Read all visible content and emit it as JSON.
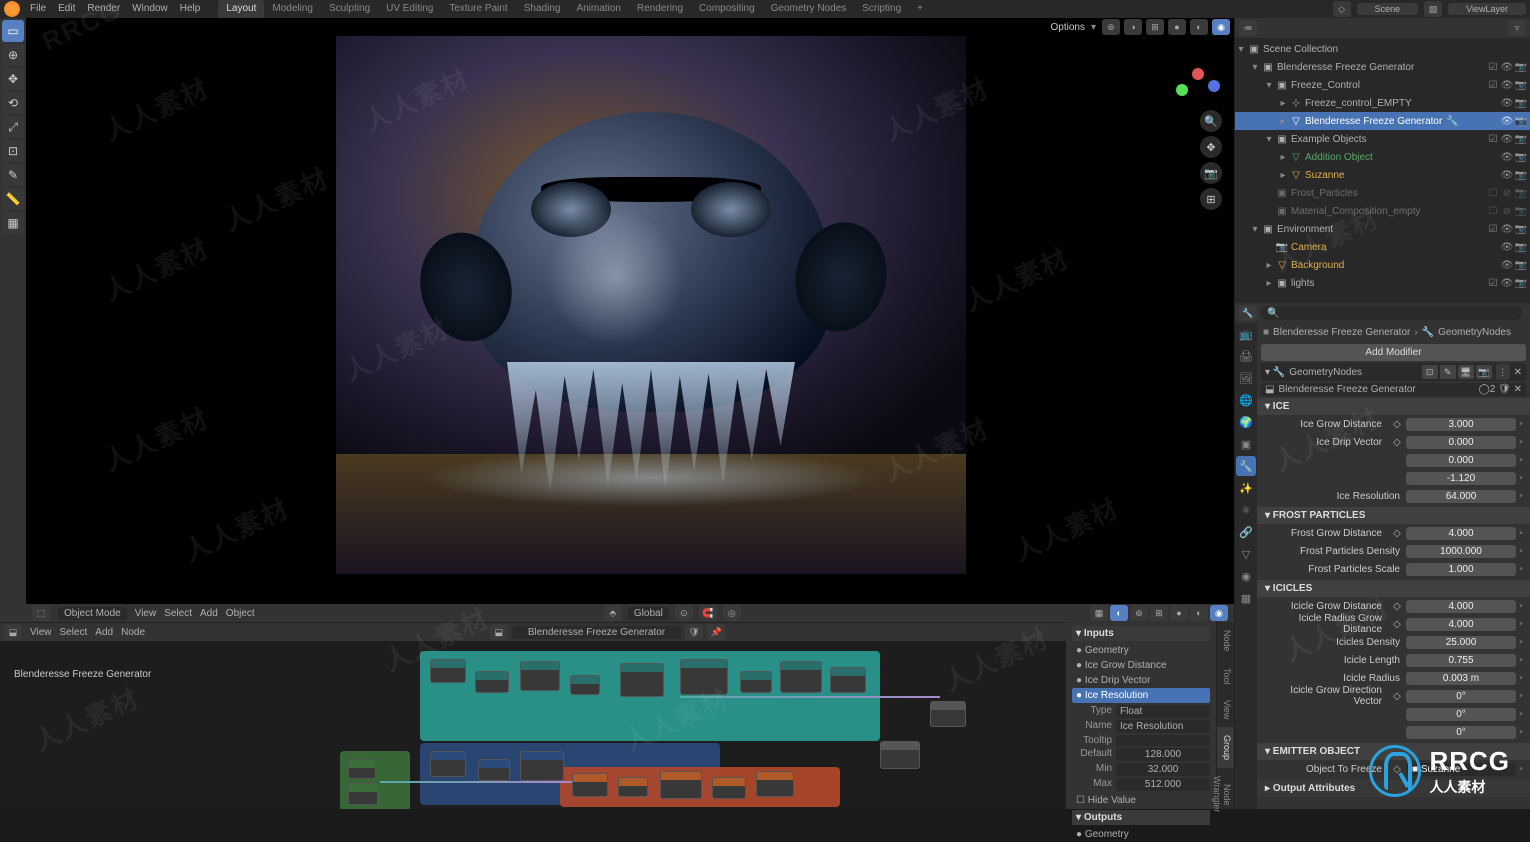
{
  "menu": [
    "File",
    "Edit",
    "Render",
    "Window",
    "Help"
  ],
  "workspaces": [
    "Layout",
    "Modeling",
    "Sculpting",
    "UV Editing",
    "Texture Paint",
    "Shading",
    "Animation",
    "Rendering",
    "Compositing",
    "Geometry Nodes",
    "Scripting"
  ],
  "workspace_active": "Layout",
  "scene": "Scene",
  "viewlayer": "ViewLayer",
  "viewport_header": {
    "mode": "Object Mode",
    "menus": [
      "View",
      "Select",
      "Add",
      "Object"
    ],
    "orientation": "Global",
    "options": "Options"
  },
  "node_editor_header": {
    "menus": [
      "View",
      "Select",
      "Add",
      "Node"
    ],
    "group": "Blenderesse Freeze Generator",
    "object": "Blenderesse Freeze Generator"
  },
  "outliner": [
    {
      "depth": 0,
      "twist": "▾",
      "icon": "▣",
      "name": "Scene Collection",
      "toggles": []
    },
    {
      "depth": 1,
      "twist": "▾",
      "icon": "▣",
      "name": "Blenderesse Freeze Generator",
      "toggles": [
        "☑",
        "👁",
        "📷"
      ]
    },
    {
      "depth": 2,
      "twist": "▾",
      "icon": "▣",
      "name": "Freeze_Control",
      "toggles": [
        "☑",
        "👁",
        "📷"
      ]
    },
    {
      "depth": 3,
      "twist": "▸",
      "icon": "⊹",
      "name": "Freeze_control_EMPTY",
      "toggles": [
        "",
        "👁",
        "📷"
      ]
    },
    {
      "depth": 3,
      "twist": "▸",
      "icon": "▽",
      "name": "Blenderesse Freeze Generator",
      "sel": true,
      "toggles": [
        "",
        "👁",
        "📷"
      ],
      "mod": "🔧"
    },
    {
      "depth": 2,
      "twist": "▾",
      "icon": "▣",
      "name": "Example Objects",
      "toggles": [
        "☑",
        "👁",
        "📷"
      ]
    },
    {
      "depth": 3,
      "twist": "▸",
      "icon": "▽",
      "name": "Addition Object",
      "toggles": [
        "",
        "👁",
        "📷"
      ],
      "color": "#5aa86a"
    },
    {
      "depth": 3,
      "twist": "▸",
      "icon": "▽",
      "name": "Suzanne",
      "toggles": [
        "",
        "👁",
        "📷"
      ],
      "color": "#e0b050"
    },
    {
      "depth": 2,
      "twist": "",
      "icon": "▣",
      "name": "Frost_Particles",
      "toggles": [
        "☐",
        "⊘",
        "📷"
      ],
      "dim": true
    },
    {
      "depth": 2,
      "twist": "",
      "icon": "▣",
      "name": "Material_Composition_empty",
      "toggles": [
        "☐",
        "⊘",
        "📷"
      ],
      "dim": true
    },
    {
      "depth": 1,
      "twist": "▾",
      "icon": "▣",
      "name": "Environment",
      "toggles": [
        "☑",
        "👁",
        "📷"
      ]
    },
    {
      "depth": 2,
      "twist": "",
      "icon": "📷",
      "name": "Camera",
      "toggles": [
        "",
        "👁",
        "📷"
      ],
      "color": "#e0b050"
    },
    {
      "depth": 2,
      "twist": "▸",
      "icon": "▽",
      "name": "Background",
      "toggles": [
        "",
        "👁",
        "📷"
      ],
      "color": "#e0b050"
    },
    {
      "depth": 2,
      "twist": "▸",
      "icon": "▣",
      "name": "lights",
      "toggles": [
        "☑",
        "👁",
        "📷"
      ]
    }
  ],
  "properties": {
    "breadcrumb_obj": "Blenderesse Freeze Generator",
    "breadcrumb_mod": "GeometryNodes",
    "add_modifier": "Add Modifier",
    "modifier_name": "GeometryNodes",
    "node_group": "Blenderesse Freeze Generator",
    "sections": [
      {
        "title": "ICE",
        "rows": [
          {
            "label": "Ice Grow Distance",
            "icon": "◇",
            "value": "3.000"
          },
          {
            "label": "Ice Drip Vector",
            "icon": "◇",
            "value": "0.000"
          },
          {
            "label": "",
            "value": "0.000"
          },
          {
            "label": "",
            "value": "-1.120"
          },
          {
            "label": "Ice Resolution",
            "value": "64.000"
          }
        ]
      },
      {
        "title": "FROST PARTICLES",
        "rows": [
          {
            "label": "Frost Grow Distance",
            "icon": "◇",
            "value": "4.000"
          },
          {
            "label": "Frost Particles Density",
            "value": "1000.000"
          },
          {
            "label": "Frost Particles Scale",
            "value": "1.000"
          }
        ]
      },
      {
        "title": "ICICLES",
        "rows": [
          {
            "label": "Icicle Grow Distance",
            "icon": "◇",
            "value": "4.000"
          },
          {
            "label": "Icicle Radius Grow Distance",
            "icon": "◇",
            "value": "4.000"
          },
          {
            "label": "Icicles Density",
            "value": "25.000"
          },
          {
            "label": "Icicle Length",
            "value": "0.755"
          },
          {
            "label": "Icicle Radius",
            "value": "0.003 m"
          },
          {
            "label": "Icicle Grow Direction Vector",
            "icon": "◇",
            "value": "0°"
          },
          {
            "label": "",
            "value": "0°"
          },
          {
            "label": "",
            "value": "0°"
          }
        ]
      },
      {
        "title": "EMITTER OBJECT",
        "rows": [
          {
            "label": "Object To Freeze",
            "icon": "◇",
            "value": "Suzanne",
            "obj": true
          }
        ]
      }
    ],
    "output_attrs": "Output Attributes"
  },
  "node_sidebar": {
    "inputs_header": "Inputs",
    "inputs": [
      "Geometry",
      "Ice Grow Distance",
      "Ice Drip Vector",
      "Ice Resolution"
    ],
    "input_active": 3,
    "type_label": "Type",
    "type_value": "Float",
    "name_label": "Name",
    "name_value": "Ice Resolution",
    "tooltip_label": "Tooltip",
    "tooltip_value": "",
    "default_label": "Default",
    "default_value": "128.000",
    "min_label": "Min",
    "min_value": "32.000",
    "max_label": "Max",
    "max_value": "512.000",
    "hide_value": "Hide Value",
    "outputs_header": "Outputs",
    "outputs": [
      "Geometry"
    ]
  },
  "watermark_text": "人人素材",
  "rrcg_big": "RRCG",
  "rrcg_small": "人人素材"
}
